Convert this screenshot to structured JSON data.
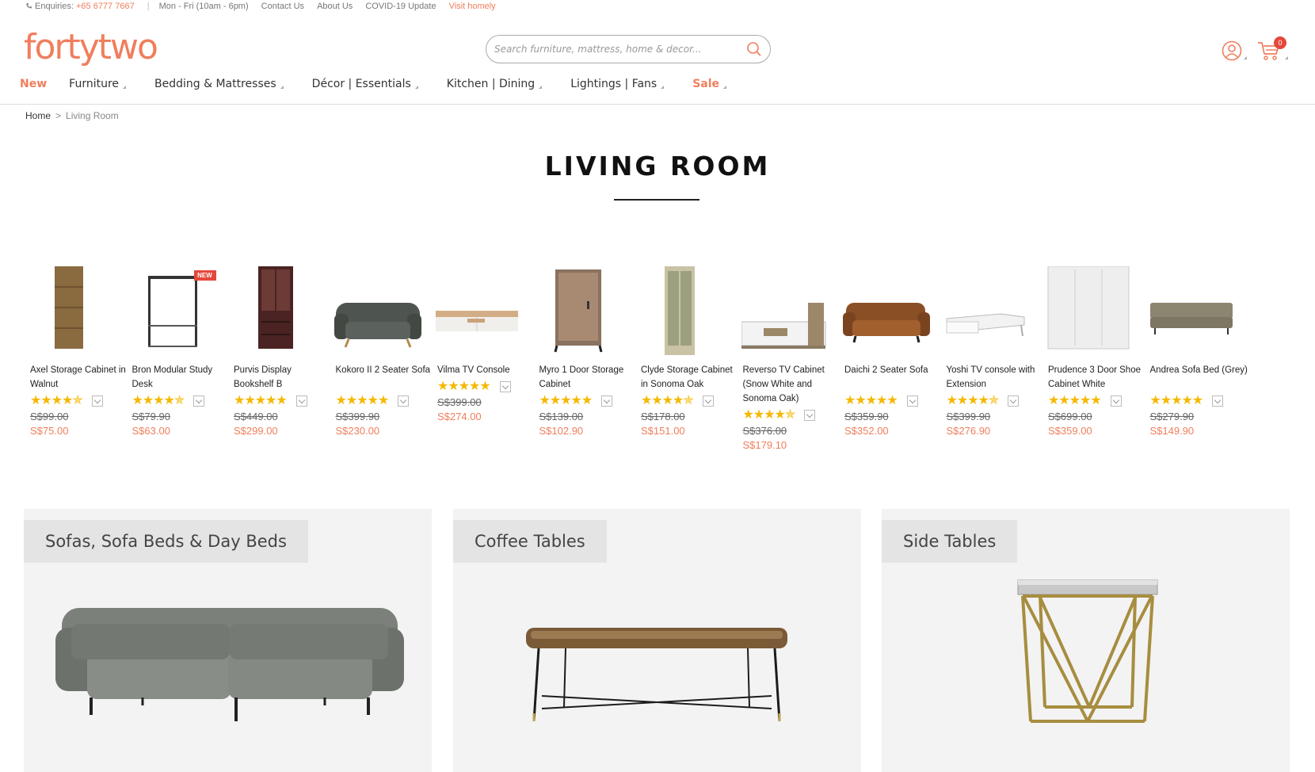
{
  "topbar": {
    "enquiries_label": "Enquiries:",
    "phone": "+65 6777 7667",
    "hours": "Mon - Fri (10am - 6pm)",
    "links": [
      "Contact Us",
      "About Us",
      "COVID-19 Update"
    ],
    "visit": "Visit homely"
  },
  "header": {
    "logo": "fortytwo",
    "search_placeholder": "Search furniture, mattress, home & decor...",
    "cart_count": "0"
  },
  "nav": {
    "items": [
      "New",
      "Furniture",
      "Bedding & Mattresses",
      "Décor | Essentials",
      "Kitchen | Dining",
      "Lightings | Fans",
      "Sale"
    ]
  },
  "breadcrumb": {
    "home": "Home",
    "separator": ">",
    "current": "Living Room"
  },
  "page_title": "LIVING ROOM",
  "products": [
    {
      "name": "Axel Storage Cabinet in Walnut",
      "old_price": "S$99.00",
      "new_price": "S$75.00",
      "rating": 4.5,
      "badge": ""
    },
    {
      "name": "Bron Modular Study Desk",
      "old_price": "S$79.90",
      "new_price": "S$63.00",
      "rating": 4.5,
      "badge": "NEW"
    },
    {
      "name": "Purvis Display Bookshelf B",
      "old_price": "S$449.00",
      "new_price": "S$299.00",
      "rating": 5,
      "badge": ""
    },
    {
      "name": "Kokoro II 2 Seater Sofa",
      "old_price": "S$399.90",
      "new_price": "S$230.00",
      "rating": 5,
      "badge": ""
    },
    {
      "name": "Vilma TV Console",
      "old_price": "S$399.00",
      "new_price": "S$274.00",
      "rating": 5,
      "badge": ""
    },
    {
      "name": "Myro 1 Door Storage Cabinet",
      "old_price": "S$139.00",
      "new_price": "S$102.90",
      "rating": 5,
      "badge": ""
    },
    {
      "name": "Clyde Storage Cabinet in Sonoma Oak",
      "old_price": "S$178.00",
      "new_price": "S$151.00",
      "rating": 4.5,
      "badge": ""
    },
    {
      "name": "Reverso TV Cabinet (Snow White and Sonoma Oak)",
      "old_price": "S$376.00",
      "new_price": "S$179.10",
      "rating": 4.5,
      "badge": ""
    },
    {
      "name": "Daichi 2 Seater Sofa",
      "old_price": "S$359.90",
      "new_price": "S$352.00",
      "rating": 5,
      "badge": ""
    },
    {
      "name": "Yoshi TV console with Extension",
      "old_price": "S$399.90",
      "new_price": "S$276.90",
      "rating": 4.5,
      "badge": ""
    },
    {
      "name": "Prudence 3 Door Shoe Cabinet White",
      "old_price": "S$699.00",
      "new_price": "S$359.00",
      "rating": 5,
      "badge": ""
    },
    {
      "name": "Andrea Sofa Bed (Grey)",
      "old_price": "S$279.90",
      "new_price": "S$149.90",
      "rating": 5,
      "badge": ""
    }
  ],
  "categories": [
    "Sofas, Sofa Beds & Day Beds",
    "Coffee Tables",
    "Side Tables"
  ],
  "colors": {
    "accent": "#f07e5c",
    "star": "#f5b800",
    "badge_red": "#e5473b"
  }
}
